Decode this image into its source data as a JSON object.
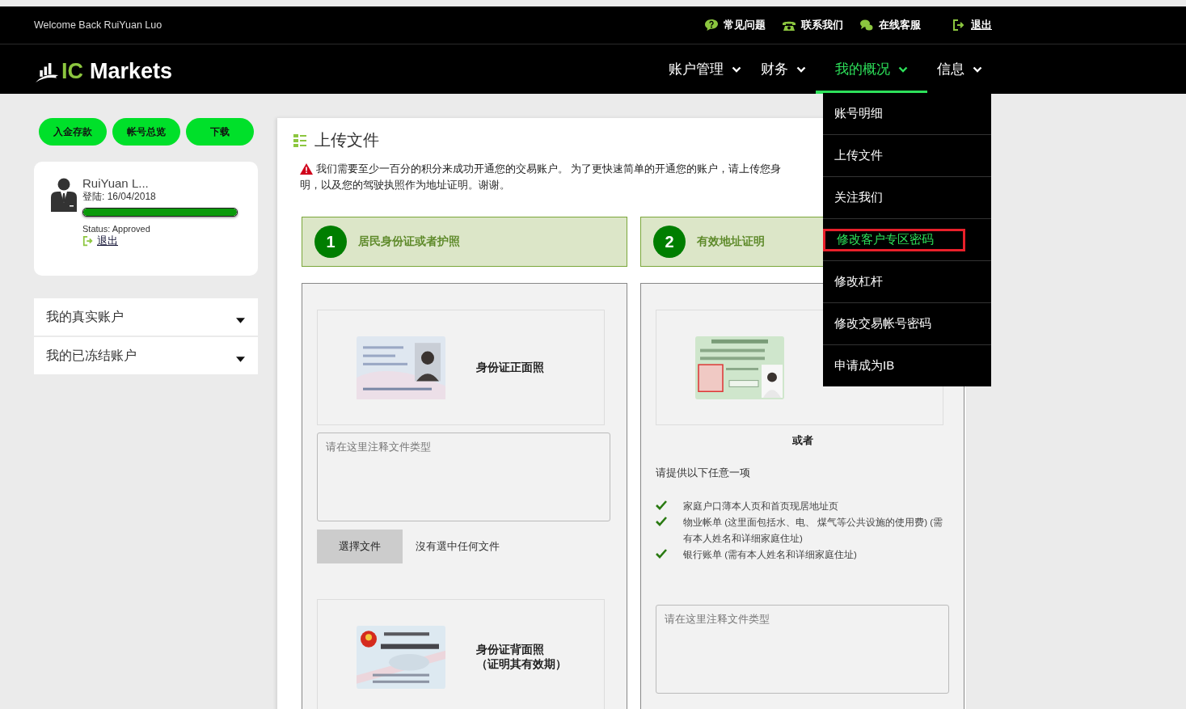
{
  "top_bar": {
    "welcome": "Welcome Back RuiYuan Luo",
    "links": [
      {
        "kind": "faq",
        "label": "常见问题"
      },
      {
        "kind": "phone",
        "label": "联系我们"
      },
      {
        "kind": "chat",
        "label": "在线客服"
      },
      {
        "kind": "logout",
        "label": "退出"
      }
    ]
  },
  "logo": {
    "accent": "IC",
    "text": "Markets"
  },
  "nav": [
    {
      "label": "账户管理",
      "selected": false
    },
    {
      "label": "财务",
      "selected": false
    },
    {
      "label": "我的概况",
      "selected": true
    },
    {
      "label": "信息",
      "selected": false
    }
  ],
  "dropdown": [
    {
      "label": "账号明细",
      "highlighted": false
    },
    {
      "label": "上传文件",
      "highlighted": false
    },
    {
      "label": "关注我们",
      "highlighted": false
    },
    {
      "label": "修改客户专区密码",
      "highlighted": true
    },
    {
      "label": "修改杠杆",
      "highlighted": false
    },
    {
      "label": "修改交易帐号密码",
      "highlighted": false
    },
    {
      "label": "申请成为IB",
      "highlighted": false
    }
  ],
  "sidebar": {
    "buttons": [
      "入金存款",
      "帐号总览",
      "下载"
    ],
    "profile": {
      "name": "RuiYuan L...",
      "login": "登陆: 16/04/2018",
      "level": 1,
      "status": "Status: Approved",
      "logout": "退出"
    },
    "accounts": [
      {
        "label": "我的真实账户"
      },
      {
        "label": "我的已冻结账户"
      }
    ]
  },
  "main": {
    "title": "上传文件",
    "notice": [
      "我们需要至少一百分的积分来成功开通您的交易账户。 为了更快速简单的开通您的账户，请上传您身",
      "明，以及您的驾驶执照作为地址证明。谢谢。"
    ],
    "steps": [
      {
        "number": "1",
        "label": "居民身份证或者护照"
      },
      {
        "number": "2",
        "label": "有效地址证明"
      }
    ],
    "column_1": {
      "front_caption": "身份证正面照",
      "note_placeholder": "请在这里注释文件类型",
      "file_button": "選擇文件",
      "file_status": "沒有選中任何文件",
      "back_caption": [
        "身份证背面照",
        "（证明其有效期）"
      ]
    },
    "column_2": {
      "or": "或者",
      "prompt": "请提供以下任意一项",
      "options": [
        "家庭户口薄本人页和首页现居地址页",
        "物业帐单 (这里面包括水、电、 煤气等公共设施的使用费) (需有本人姓名和详细家庭住址)",
        "银行账单 (需有本人姓名和详细家庭住址)"
      ],
      "note_placeholder": "请在这里注释文件类型"
    }
  }
}
